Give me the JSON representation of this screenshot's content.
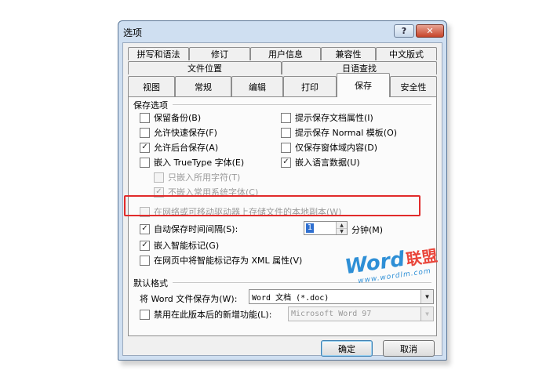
{
  "window": {
    "title": "选项",
    "help_label": "?",
    "close_label": "✕"
  },
  "tabs": {
    "row1": [
      "拼写和语法",
      "修订",
      "用户信息",
      "兼容性",
      "中文版式"
    ],
    "row2": [
      "文件位置",
      "日语查找"
    ],
    "row3": [
      "视图",
      "常规",
      "编辑",
      "打印",
      "保存",
      "安全性"
    ],
    "active": "保存"
  },
  "save_options": {
    "group_label": "保存选项",
    "left": [
      {
        "label": "保留备份(B)",
        "checked": false
      },
      {
        "label": "允许快速保存(F)",
        "checked": false
      },
      {
        "label": "允许后台保存(A)",
        "checked": true
      },
      {
        "label": "嵌入 TrueType 字体(E)",
        "checked": false
      },
      {
        "label": "只嵌入所用字符(T)",
        "checked": false,
        "disabled": true
      },
      {
        "label": "不嵌入常用系统字体(C)",
        "checked": true,
        "disabled": true
      }
    ],
    "right": [
      {
        "label": "提示保存文档属性(I)",
        "checked": false
      },
      {
        "label": "提示保存 Normal 模板(O)",
        "checked": false
      },
      {
        "label": "仅保存窗体域内容(D)",
        "checked": false
      },
      {
        "label": "嵌入语言数据(U)",
        "checked": true
      }
    ],
    "local_copy": {
      "label": "在网络或可移动驱动器上存储文件的本地副本(W)",
      "checked": false
    },
    "autosave": {
      "label": "自动保存时间间隔(S):",
      "checked": true,
      "value": "1",
      "unit": "分钟(M)"
    },
    "smart_tags": {
      "label": "嵌入智能标记(G)",
      "checked": true
    },
    "smart_tags_xml": {
      "label": "在网页中将智能标记存为 XML 属性(V)",
      "checked": false
    }
  },
  "default_format": {
    "group_label": "默认格式",
    "save_as_label": "将 Word 文件保存为(W):",
    "save_as_value": "Word 文档 (*.doc)",
    "disable_features_label": "禁用在此版本后的新增功能(L):",
    "disable_features_checked": false,
    "version_value": "Microsoft Word 97"
  },
  "watermark": {
    "word": "Word",
    "cn": "联盟",
    "url": "www.wordlm.com"
  },
  "buttons": {
    "ok": "确定",
    "cancel": "取消"
  },
  "colors": {
    "highlight": "#e12b2b",
    "titlebar": "#cfdff1",
    "close_button": "#c7452a"
  }
}
